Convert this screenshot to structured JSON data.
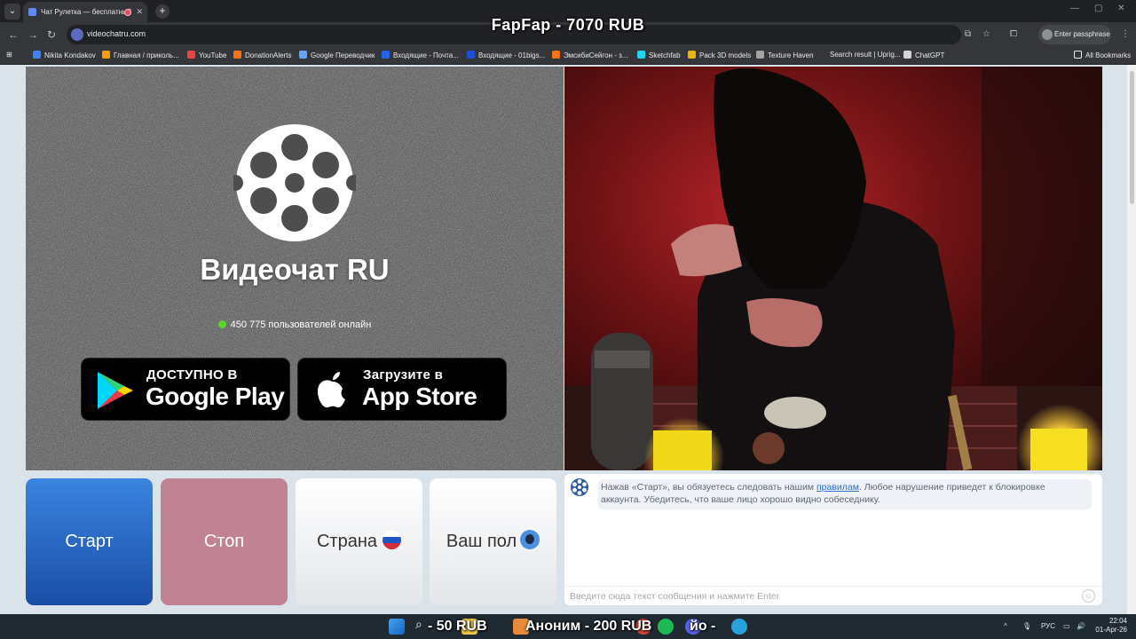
{
  "overlay": {
    "title": "FapFap - 7070 RUB"
  },
  "browser": {
    "tab_title": "Чат Рулетка — бесплатный",
    "url": "videochatru.com",
    "profile_label": "Enter passphrase",
    "bookmarks": [
      "Nikita Kondakov",
      "Главная / приколь...",
      "YouTube",
      "DonationAlerts",
      "Google Переводчик",
      "Входящие - Почта...",
      "Входящие - 01bigs...",
      "ЭмсибиСейгон - з...",
      "Sketchfab",
      "Pack 3D models",
      "Texture Haven",
      "Search result | Uprig...",
      "ChatGPT"
    ],
    "all_bookmarks": "All Bookmarks"
  },
  "site": {
    "brand": "Видеочат RU",
    "online_text": "450 775 пользователей онлайн",
    "google_play": {
      "small": "ДОСТУПНО В",
      "big": "Google Play"
    },
    "app_store": {
      "small": "Загрузите в",
      "big": "App Store"
    },
    "buttons": {
      "start": "Старт",
      "stop": "Стоп",
      "country": "Страна",
      "gender": "Ваш пол"
    },
    "chat": {
      "notice_before": "Нажав «Старт», вы обязуетесь следовать нашим ",
      "notice_link": "правилам",
      "notice_after": ". Любое нарушение приведет к блокировке аккаунта. Убедитесь, что ваше лицо хорошо видно собеседнику.",
      "input_placeholder": "Введите сюда текст сообщения и нажмите Enter"
    }
  },
  "taskbar": {
    "donation_1": "- 50 RUB",
    "donation_2": "Аноним - 200 RUB",
    "donation_3": "йо -",
    "lang": "РУС",
    "time": "22:04",
    "date": "01-Apr-26"
  },
  "colors": {
    "start": "#2a6ccb",
    "stop": "#c18294",
    "online_dot": "#59d62a"
  }
}
